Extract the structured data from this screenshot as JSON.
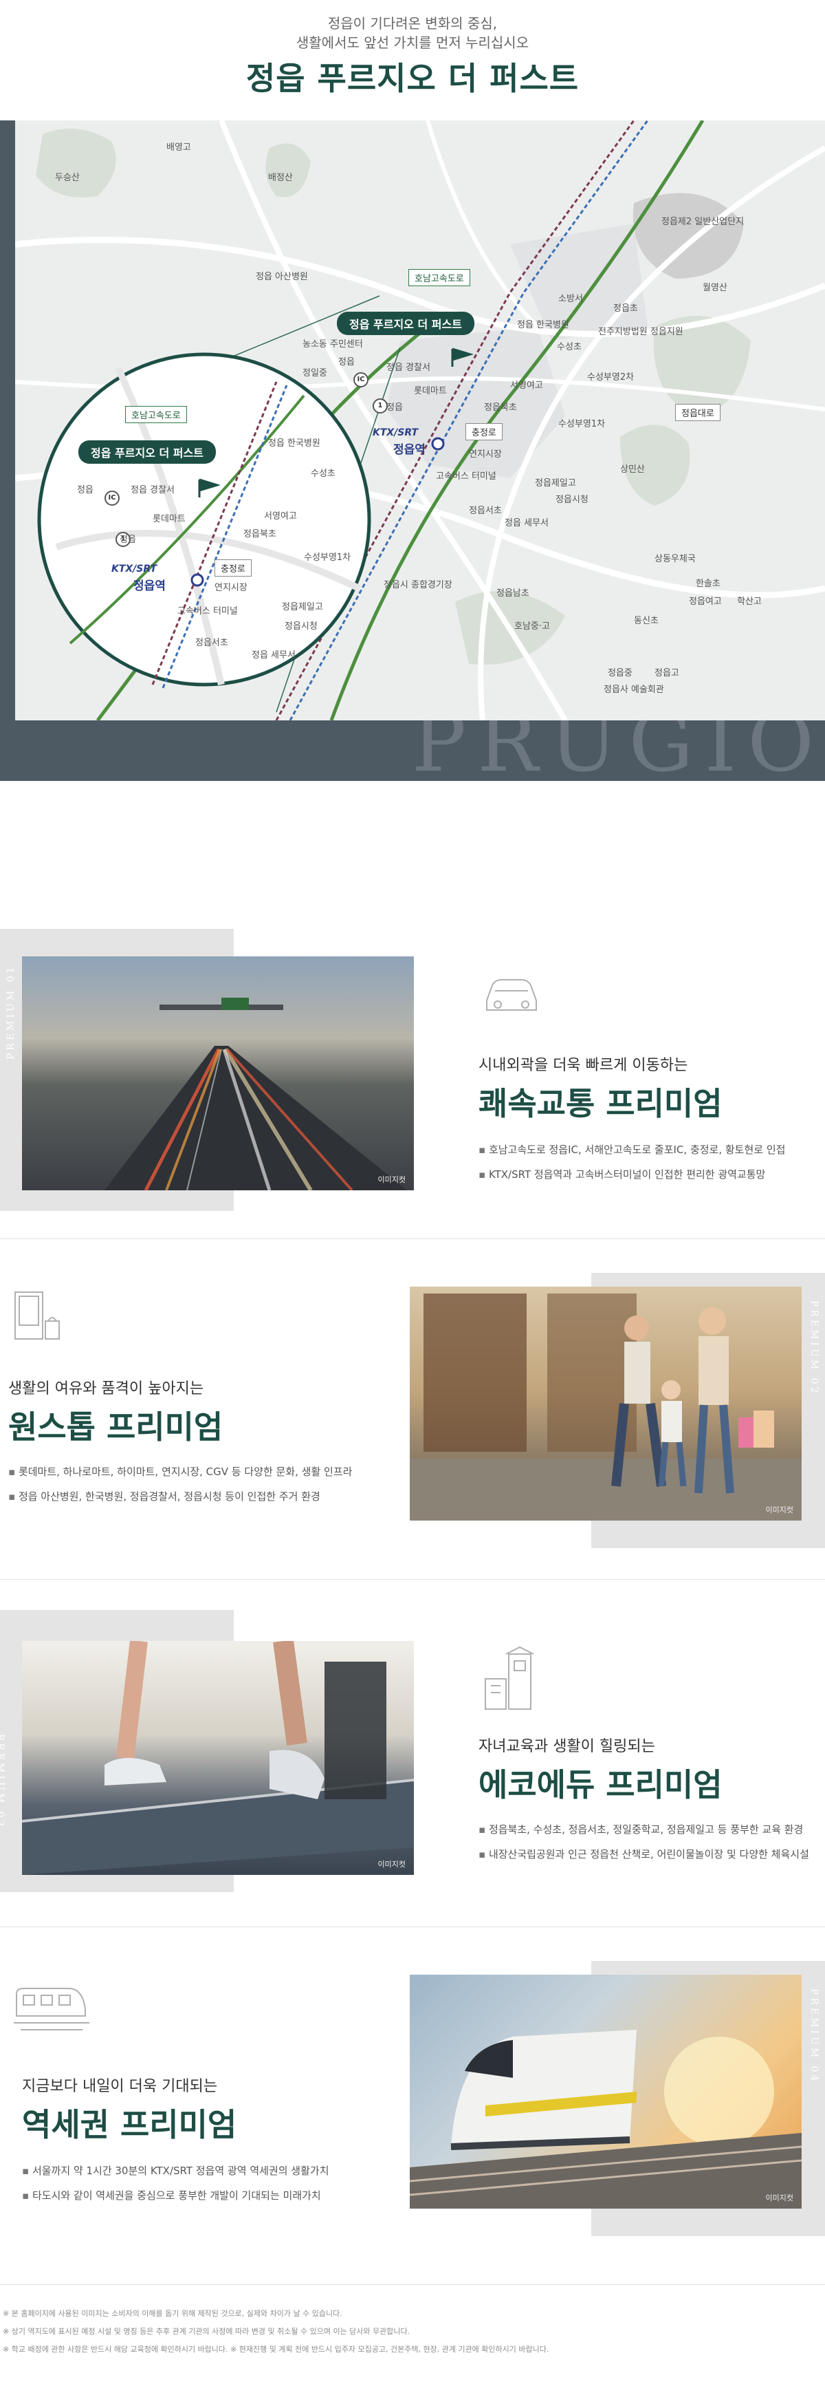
{
  "hero": {
    "line1": "정읍이 기다려온 변화의 중심,",
    "line2": "생활에서도 앞선 가치를 먼저 누리십시오",
    "title": "정읍 푸르지오 더 퍼스트"
  },
  "map": {
    "watermark": "PRUGIO",
    "pill_main": "정읍 푸르지오 더 퍼스트",
    "pill_zoom": "정읍 푸르지오 더 퍼스트",
    "ktx_logo": "KTX/SRT",
    "station": "정읍역",
    "ktx_logo_zoom": "KTX/SRT",
    "station_zoom": "정읍역",
    "road_tags": {
      "honam": "호남고속도로",
      "honam_zoom": "호남고속도로",
      "jungjeong": "충정로",
      "jungjeong_zoom": "충정로",
      "jeongeupdae": "정읍대로"
    },
    "ic": "IC",
    "route_no": "1",
    "route_no_zoom": "1",
    "ic_zoom": "IC",
    "labels": {
      "baekyang": "배영고",
      "dusan": "두승산",
      "baekjeong": "배정산",
      "asan": "정읍 아산병원",
      "nongso": "농소동 주민센터",
      "jeongiljung": "정일중",
      "jeongeup_a": "정읍",
      "police": "정읍 경찰서",
      "lotte": "롯데마트",
      "jeongeup_b": "정읍",
      "hanguk": "정읍 한국병원",
      "suseong": "수성초",
      "jeonju": "전주지방법원 정읍지원",
      "sobangseo": "소방서",
      "jeongcho": "정읍초",
      "suseong_pyeong2": "수성부영2차",
      "jeongeup2": "정읍제2 일반산업단지",
      "wolyeong": "월영산",
      "seoyeong": "서영여고",
      "jeongbuk": "정읍북초",
      "suseong_pyeong1": "수성부영1차",
      "yeonji": "연지시장",
      "terminal": "고속버스 터미널",
      "jeongseo": "정읍서초",
      "jeongil_god": "정읍제일고",
      "jeongeup_city": "정읍시청",
      "seomu": "정읍 세무서",
      "sangmin": "상민산",
      "sports": "정읍시 종합경기장",
      "jeongnam": "정읍남초",
      "honamjunggo": "호남중·고",
      "sangdong": "상동우체국",
      "hanrim": "한솔초",
      "jeongyeo": "정읍여고",
      "haksan": "학산고",
      "dongsin": "동신초",
      "jeongjung": "정읍중",
      "jeonggo": "정읍고",
      "art": "정읍사 예술회관",
      "z_jeongeup1": "정읍",
      "z_police": "정읍 경찰서",
      "z_lotte": "롯데마트",
      "z_jeongeup2": "정읍",
      "z_hanguk": "정읍 한국병원",
      "z_suseong": "수성초",
      "z_seoyeong": "서영여고",
      "z_jeongbuk": "정읍북초",
      "z_suseong1": "수성부영1차",
      "z_yeonji": "연지시장",
      "z_terminal": "고속버스 터미널",
      "z_jeongil": "정읍제일고",
      "z_city": "정읍시청",
      "z_seochoo": "정읍서초",
      "z_seomu": "정읍 세무서"
    }
  },
  "sections": [
    {
      "tag": "PREMIUM 01",
      "sub": "시내외곽을 더욱 빠르게 이동하는",
      "head": "쾌속교통 프리미엄",
      "bullets": [
        "호남고속도로 정읍IC, 서해안고속도로 줄포IC, 충정로, 황토현로 인접",
        "KTX/SRT 정읍역과 고속버스터미널이 인접한 편리한 광역교통망"
      ],
      "caption": "이미지컷",
      "icon": "car-icon"
    },
    {
      "tag": "PREMIUM 02",
      "sub": "생활의 여유와 품격이 높아지는",
      "head": "원스톱 프리미엄",
      "bullets": [
        "롯데마트, 하나로마트, 하이마트, 연지시장, CGV 등 다양한 문화, 생활 인프라",
        "정읍 아산병원, 한국병원, 정읍경찰서, 정읍시청 등이 인접한 주거 환경"
      ],
      "caption": "이미지컷",
      "icon": "shop-icon"
    },
    {
      "tag": "PREMIUM 03",
      "sub": "자녀교육과 생활이 힐링되는",
      "head": "에코에듀 프리미엄",
      "bullets": [
        "정읍북초, 수성초, 정읍서초, 정일중학교, 정읍제일고 등 풍부한 교육 환경",
        "내장산국립공원과 인근 정읍천 산책로, 어린이물놀이장 및 다양한 체육시설"
      ],
      "caption": "이미지컷",
      "icon": "school-icon"
    },
    {
      "tag": "PREMIUM 04",
      "sub": "지금보다 내일이 더욱 기대되는",
      "head": "역세권 프리미엄",
      "bullets": [
        "서울까지 약 1시간 30분의 KTX/SRT 정읍역 광역 역세권의 생활가치",
        "타도시와 같이 역세권을 중심으로 풍부한 개발이 기대되는 미래가치"
      ],
      "caption": "이미지컷",
      "icon": "train-icon"
    }
  ],
  "notes": [
    "※ 본 홈페이지에 사용된 이미지는 소비자의 이해를 돕기 위해 제작된 것으로, 실제와 차이가 날 수 있습니다.",
    "※ 상기 역지도에 표시된 예정 시설 및 명칭 등은 추후 관계 기관의 사정에 따라 변경 및 취소될 수 있으며 이는 당사와 무관합니다.",
    "※ 학교 배정에 관한 사항은 반드시 해당 교육청에 확인하시기 바랍니다. ※ 현재진행 및 계획 전에 반드시 입주자 모집공고, 건본주택, 현장, 관계 기관에 확인하시기 바랍니다."
  ]
}
